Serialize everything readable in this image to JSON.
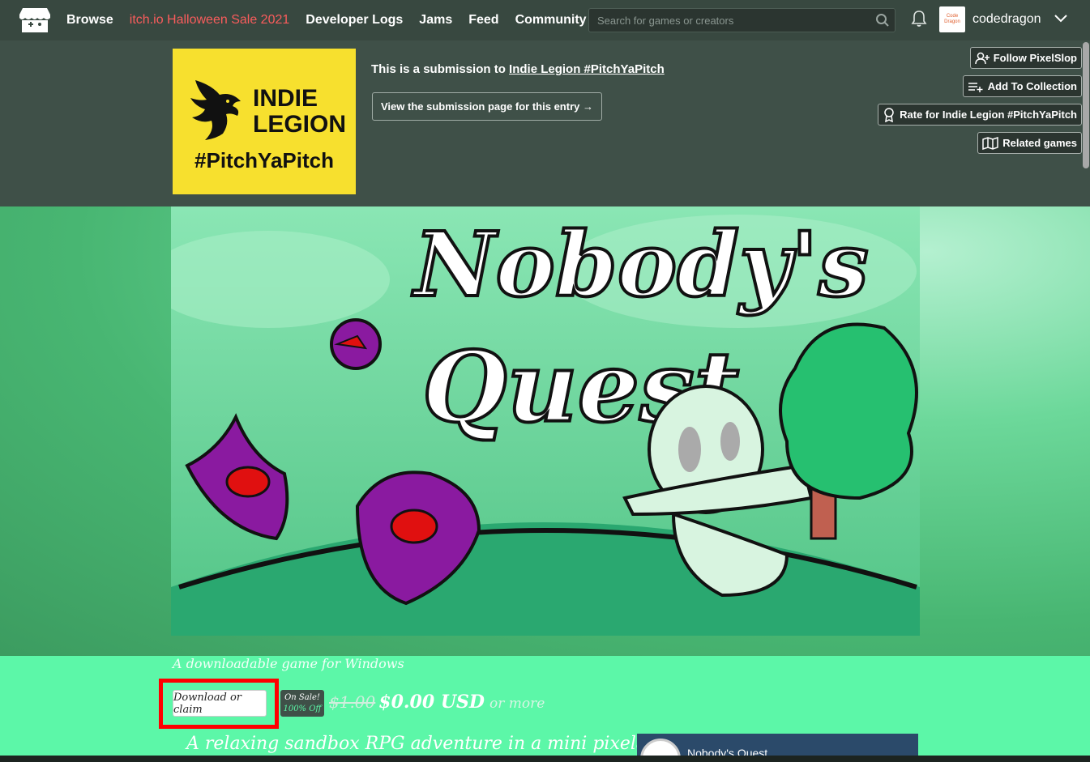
{
  "nav": {
    "browse": "Browse",
    "sale": "itch.io Halloween Sale 2021",
    "devlogs": "Developer Logs",
    "jams": "Jams",
    "feed": "Feed",
    "community": "Community"
  },
  "search": {
    "placeholder": "Search for games or creators"
  },
  "user": {
    "name": "codedragon",
    "avatar_text": "Code Dragon"
  },
  "jam": {
    "logo_line1": "INDIE",
    "logo_line2": "LEGION",
    "logo_tag": "#PitchYaPitch",
    "submission_prefix": "This is a submission to ",
    "submission_link": "Indie Legion #PitchYaPitch",
    "view_button": "View the submission page for this entry →"
  },
  "actions": {
    "follow": "Follow PixelSlop",
    "collection": "Add To Collection",
    "rate": "Rate for Indie Legion #PitchYaPitch",
    "related": "Related games"
  },
  "banner": {
    "title_line1": "Nobody's",
    "title_line2": "Quest"
  },
  "game": {
    "subtitle": "A downloadable game for Windows",
    "download_button": "Download or claim",
    "sale_line1": "On Sale!",
    "sale_line2": "100% Off",
    "old_price": "$1.00",
    "new_price": "$0.00 USD",
    "or_more": "or more",
    "tagline": "A relaxing sandbox RPG adventure in a mini pixelated open",
    "video_title": "Nobody's Quest ..."
  },
  "colors": {
    "accent": "#fa5c5c",
    "page_bg": "#5cf7a8",
    "header_bg": "#3f5048",
    "highlight": "#ff0000"
  }
}
